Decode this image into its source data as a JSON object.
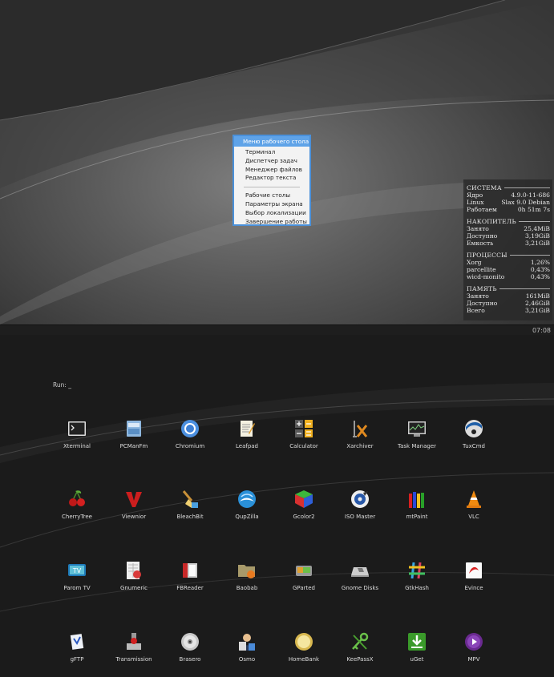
{
  "desktop_menu": {
    "title": "Меню рабочего стола",
    "group1": [
      "Терминал",
      "Диспетчер задач",
      "Менеджер файлов",
      "Редактор текста"
    ],
    "group2": [
      "Рабочие столы",
      "Параметры экрана",
      "Выбор локализации",
      "Завершение работы"
    ]
  },
  "conky": {
    "system": {
      "title": "СИСТЕМА",
      "rows": [
        {
          "k": "Ядро",
          "v": "4.9.0-11-686"
        },
        {
          "k": "Linux",
          "v": "Slax 9.0 Debian"
        },
        {
          "k": "Работаем",
          "v": "0h 51m 7s"
        }
      ]
    },
    "storage": {
      "title": "НАКОПИТЕЛЬ",
      "rows": [
        {
          "k": "Занято",
          "v": "25,4MiB"
        },
        {
          "k": "Доступно",
          "v": "3,19GiB"
        },
        {
          "k": "Емкость",
          "v": "3,21GiB"
        }
      ]
    },
    "processes": {
      "title": "ПРОЦЕССЫ",
      "rows": [
        {
          "k": "Xorg",
          "v": "1,26%"
        },
        {
          "k": "parcellite",
          "v": "0,43%"
        },
        {
          "k": "wicd-monito",
          "v": "0,43%"
        }
      ]
    },
    "memory": {
      "title": "ПАМЯТЬ",
      "rows": [
        {
          "k": "Занято",
          "v": "161MiB"
        },
        {
          "k": "Доступно",
          "v": "2,46GiB"
        },
        {
          "k": "Всего",
          "v": "3,21GiB"
        }
      ]
    }
  },
  "taskbar": {
    "clock": "07:08"
  },
  "launcher": {
    "run_prompt": "Run: _",
    "apps": [
      {
        "label": "Xterminal",
        "icon": "terminal-icon"
      },
      {
        "label": "PCManFm",
        "icon": "file-manager-icon"
      },
      {
        "label": "Chromium",
        "icon": "chromium-icon"
      },
      {
        "label": "Leafpad",
        "icon": "text-editor-icon"
      },
      {
        "label": "Calculator",
        "icon": "calculator-icon"
      },
      {
        "label": "Xarchiver",
        "icon": "archiver-icon"
      },
      {
        "label": "Task Manager",
        "icon": "task-manager-icon"
      },
      {
        "label": "TuxCmd",
        "icon": "tuxcmd-icon"
      },
      {
        "label": "CherryTree",
        "icon": "cherry-icon"
      },
      {
        "label": "Viewnior",
        "icon": "viewnior-icon"
      },
      {
        "label": "BleachBit",
        "icon": "broom-icon"
      },
      {
        "label": "QupZilla",
        "icon": "qupzilla-icon"
      },
      {
        "label": "Gcolor2",
        "icon": "color-cube-icon"
      },
      {
        "label": "ISO Master",
        "icon": "disc-icon"
      },
      {
        "label": "mtPaint",
        "icon": "pencils-icon"
      },
      {
        "label": "VLC",
        "icon": "vlc-cone-icon"
      },
      {
        "label": "Parom TV",
        "icon": "tv-icon"
      },
      {
        "label": "Gnumeric",
        "icon": "spreadsheet-icon"
      },
      {
        "label": "FBReader",
        "icon": "book-icon"
      },
      {
        "label": "Baobab",
        "icon": "folder-chart-icon"
      },
      {
        "label": "GParted",
        "icon": "drive-icon"
      },
      {
        "label": "Gnome Disks",
        "icon": "disks-icon"
      },
      {
        "label": "GtkHash",
        "icon": "hash-icon"
      },
      {
        "label": "Evince",
        "icon": "document-viewer-icon"
      },
      {
        "label": "gFTP",
        "icon": "ftp-icon"
      },
      {
        "label": "Transmission",
        "icon": "transmission-icon"
      },
      {
        "label": "Brasero",
        "icon": "cd-icon"
      },
      {
        "label": "Osmo",
        "icon": "organizer-icon"
      },
      {
        "label": "HomeBank",
        "icon": "coin-icon"
      },
      {
        "label": "KeePassX",
        "icon": "keys-icon"
      },
      {
        "label": "uGet",
        "icon": "download-icon"
      },
      {
        "label": "MPV",
        "icon": "play-icon"
      }
    ]
  }
}
